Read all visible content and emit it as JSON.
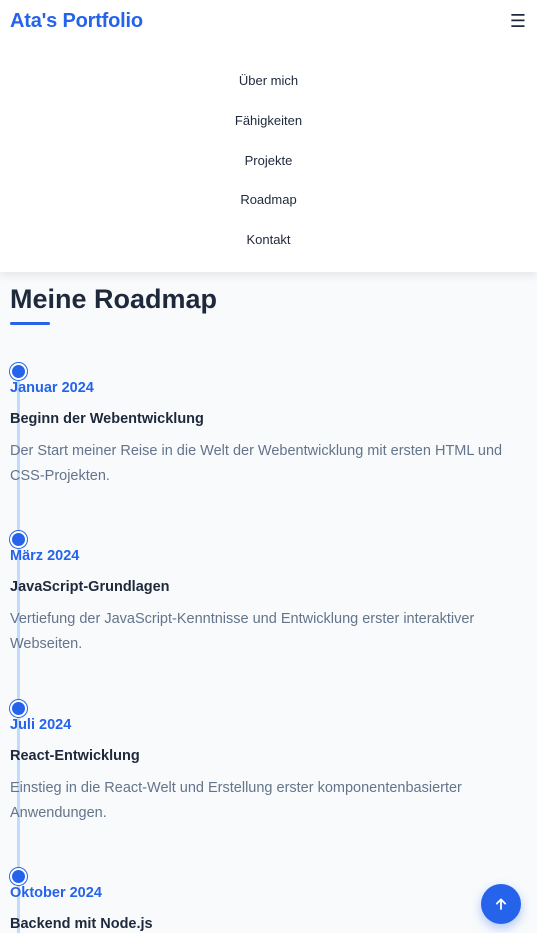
{
  "header": {
    "logo": "Ata's Portfolio",
    "menu_icon": "☰"
  },
  "nav": {
    "items": [
      {
        "label": "Über mich"
      },
      {
        "label": "Fähigkeiten"
      },
      {
        "label": "Projekte"
      },
      {
        "label": "Roadmap"
      },
      {
        "label": "Kontakt"
      }
    ]
  },
  "roadmap": {
    "title": "Meine Roadmap",
    "items": [
      {
        "date": "Januar 2024",
        "title": "Beginn der Webentwicklung",
        "description": "Der Start meiner Reise in die Welt der Webentwicklung mit ersten HTML und CSS-Projekten."
      },
      {
        "date": "März 2024",
        "title": "JavaScript-Grundlagen",
        "description": "Vertiefung der JavaScript-Kenntnisse und Entwicklung erster interaktiver Webseiten."
      },
      {
        "date": "Juli 2024",
        "title": "React-Entwicklung",
        "description": "Einstieg in die React-Welt und Erstellung erster komponentenbasierter Anwendungen."
      },
      {
        "date": "Oktober 2024",
        "title": "Backend mit Node.js",
        "description": ""
      }
    ]
  },
  "back_to_top": {
    "icon": "arrow-up-icon"
  },
  "colors": {
    "accent": "#2563eb",
    "text": "#1e293b",
    "muted": "#64748b",
    "timeline_line": "#bfdbfe",
    "background": "#f8fafc"
  }
}
